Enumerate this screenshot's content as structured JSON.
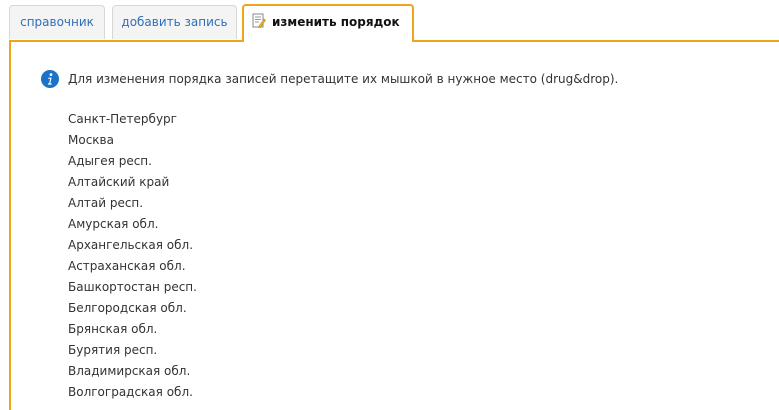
{
  "tabs": {
    "reference": "справочник",
    "add_record": "добавить запись",
    "change_order": "изменить порядок"
  },
  "info": {
    "icon": "info-icon",
    "text": "Для изменения порядка записей перетащите их мышкой в нужное место (drug&drop)."
  },
  "regions": [
    "Санкт-Петербург",
    "Москва",
    "Адыгея респ.",
    "Алтайский край",
    "Алтай респ.",
    "Амурская обл.",
    "Архангельская обл.",
    "Астраханская обл.",
    "Башкортостан респ.",
    "Белгородская обл.",
    "Брянская обл.",
    "Бурятия респ.",
    "Владимирская обл.",
    "Волгоградская обл."
  ],
  "colors": {
    "accent": "#f0a41b",
    "link": "#2f6fb7",
    "info": "#1a73c8"
  }
}
